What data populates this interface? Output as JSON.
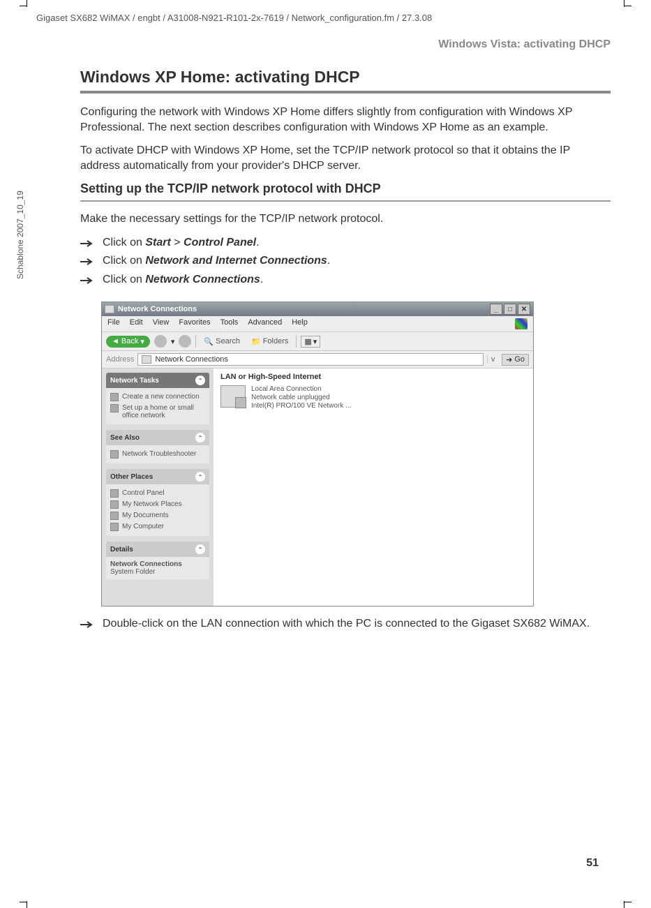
{
  "header_path": "Gigaset SX682 WiMAX / engbt / A31008-N921-R101-2x-7619 / Network_configuration.fm / 27.3.08",
  "side_label": "Schablone 2007_10_19",
  "running_head": "Windows Vista: activating DHCP",
  "h1": "Windows XP Home: activating DHCP",
  "para1": "Configuring the network with Windows XP Home differs slightly from configuration with Windows XP Professional. The next section describes configuration with Windows XP Home as an example.",
  "para2": "To activate DHCP with Windows XP Home, set the TCP/IP network protocol so that it obtains the IP address automatically from your provider's DHCP server.",
  "h2": "Setting up the TCP/IP network protocol with DHCP",
  "para3": "Make the necessary settings for the TCP/IP network protocol.",
  "step1_pre": "Click on ",
  "step1_b1": "Start",
  "step1_mid": " > ",
  "step1_b2": "Control Panel",
  "step1_post": ".",
  "step2_pre": "Click on ",
  "step2_b": "Network and Internet Connections",
  "step2_post": ".",
  "step3_pre": "Click on ",
  "step3_b": "Network Connections",
  "step3_post": ".",
  "step4": "Double-click on the LAN connection with which the PC is connected to the Gigaset SX682 WiMAX.",
  "page_number": "51",
  "window": {
    "title": "Network Connections",
    "menu": [
      "File",
      "Edit",
      "View",
      "Favorites",
      "Tools",
      "Advanced",
      "Help"
    ],
    "toolbar": {
      "back": "Back",
      "search": "Search",
      "folders": "Folders"
    },
    "address": {
      "label": "Address",
      "value": "Network Connections",
      "go": "Go"
    },
    "side_panels": {
      "tasks": {
        "title": "Network Tasks",
        "items": [
          "Create a new connection",
          "Set up a home or small office network"
        ]
      },
      "see_also": {
        "title": "See Also",
        "items": [
          "Network Troubleshooter"
        ]
      },
      "other": {
        "title": "Other Places",
        "items": [
          "Control Panel",
          "My Network Places",
          "My Documents",
          "My Computer"
        ]
      },
      "details": {
        "title": "Details",
        "line1": "Network Connections",
        "line2": "System Folder"
      }
    },
    "main": {
      "category": "LAN or High-Speed Internet",
      "item": {
        "name": "Local Area Connection",
        "status": "Network cable unplugged",
        "adapter": "Intel(R) PRO/100 VE Network ..."
      }
    }
  }
}
